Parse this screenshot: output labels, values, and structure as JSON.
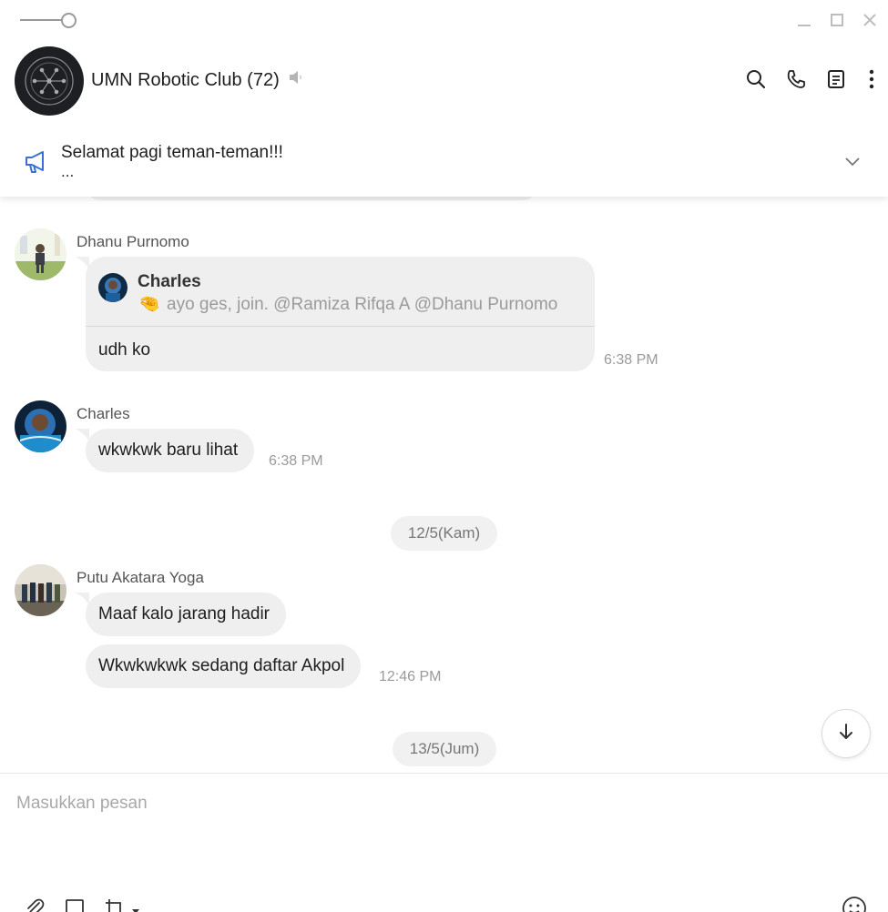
{
  "window": {
    "slider_icon": "opacity-slider-icon",
    "minimize_icon": "minimize-icon",
    "maximize_icon": "maximize-icon",
    "close_icon": "close-icon"
  },
  "header": {
    "title": "UMN Robotic Club (72)",
    "mute_icon": "speaker-muted-icon",
    "actions": [
      "search-icon",
      "phone-icon",
      "notes-icon",
      "more-vertical-icon"
    ]
  },
  "announcement": {
    "icon": "megaphone-icon",
    "text": "Selamat pagi teman-teman!!!",
    "more": "...",
    "expand_icon": "chevron-down-icon"
  },
  "messages": {
    "dhanu": {
      "sender": "Dhanu Purnomo",
      "quote": {
        "name": "Charles",
        "emoji": "🤏",
        "text": "ayo ges, join. @Ramiza Rifqa A @Dhanu Purnomo"
      },
      "text": "udh ko",
      "time": "6:38 PM"
    },
    "charles": {
      "sender": "Charles",
      "text": "wkwkwk baru lihat",
      "time": "6:38 PM"
    },
    "date1": "12/5(Kam)",
    "putu": {
      "sender": "Putu Akatara Yoga",
      "text1": "Maaf kalo jarang hadir",
      "text2": "Wkwkwkwk sedang daftar Akpol",
      "time": "12:46 PM"
    },
    "date2": "13/5(Jum)"
  },
  "composer": {
    "placeholder": "Masukkan pesan",
    "tools": [
      "paperclip-icon",
      "square-icon",
      "crop-icon",
      "emoji-icon"
    ]
  },
  "colors": {
    "bubble": "#efefef",
    "accent_blue": "#3b6fd6",
    "muted_text": "#9a9a9a"
  }
}
